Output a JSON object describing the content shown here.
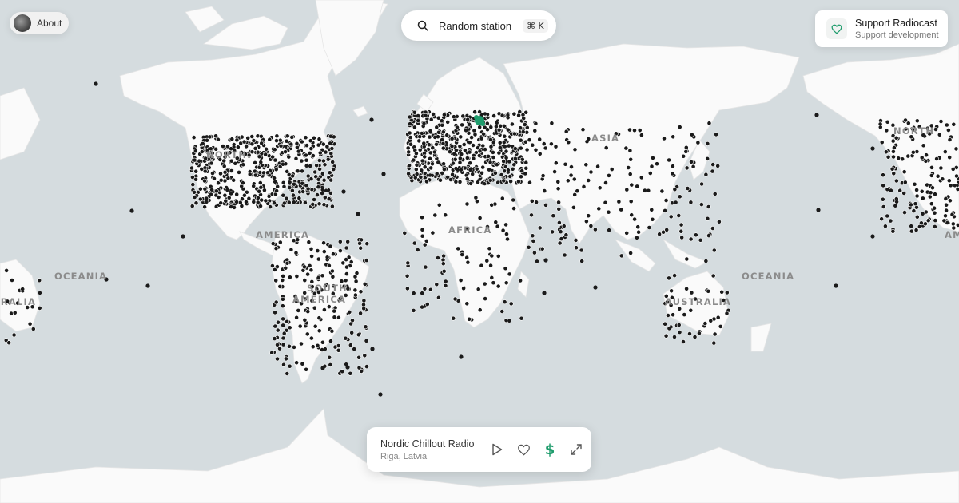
{
  "header": {
    "about_label": "About",
    "search_label": "Random station",
    "search_shortcut": "⌘ K",
    "support_title": "Support Radiocast",
    "support_subtitle": "Support development"
  },
  "map_labels": {
    "north_america": "NORTH",
    "america": "AMERICA",
    "south_america": "SOUTH",
    "south_america_2": "AMERICA",
    "africa": "AFRICA",
    "asia": "ASIA",
    "oceania": "OCEANIA",
    "australia": "AUSTRALIA"
  },
  "player": {
    "station_name": "Nordic Chillout Radio",
    "station_location": "Riga, Latvia"
  },
  "colors": {
    "accent": "#1e9c6c",
    "station_dot": "#1a1a1a",
    "water": "#d5dcdf",
    "land": "#fafafa"
  },
  "icons": {
    "search": "search-icon",
    "heart": "heart-icon",
    "play": "play-icon",
    "dollar": "dollar-icon",
    "expand": "expand-icon"
  }
}
